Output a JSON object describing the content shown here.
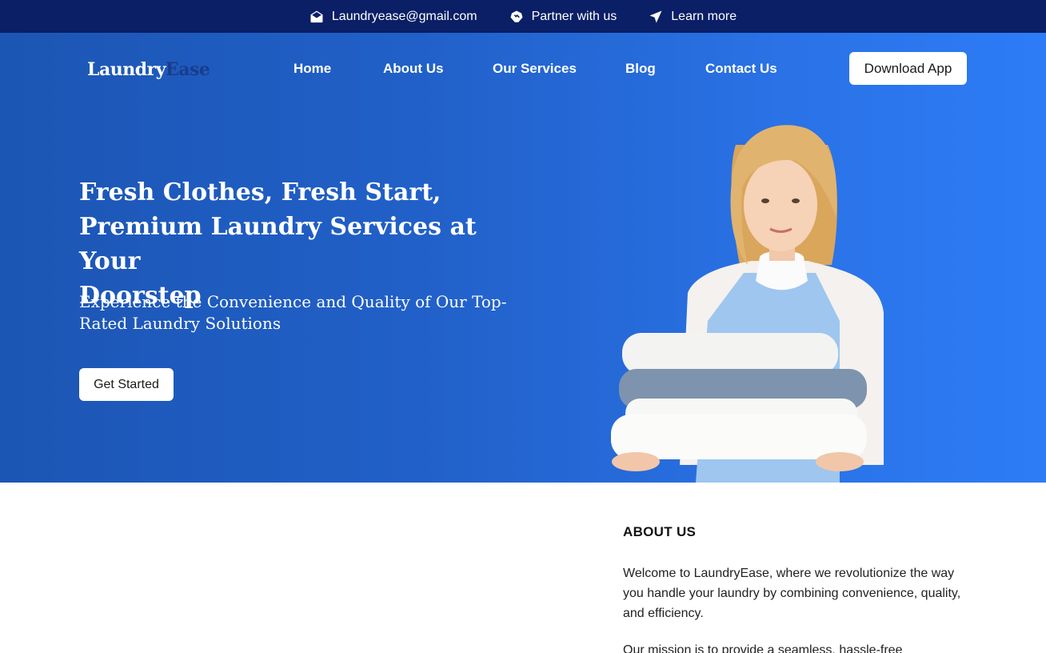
{
  "topbar": {
    "items": [
      {
        "icon": "envelope-icon",
        "label": "Laundryease@gmail.com"
      },
      {
        "icon": "handshake-icon",
        "label": "Partner with us"
      },
      {
        "icon": "send-icon",
        "label": "Learn more"
      }
    ]
  },
  "brand": {
    "part1": "Laundry",
    "part2": "Ease"
  },
  "nav": {
    "items": [
      "Home",
      "About Us",
      "Our Services",
      "Blog",
      "Contact Us"
    ],
    "cta": "Download App"
  },
  "hero": {
    "title_line1": "Fresh Clothes, Fresh Start,",
    "title_line2": "Premium Laundry Services at Your",
    "title_line3": "Doorstep",
    "subtitle": "Experience the Convenience and Quality of Our Top-Rated Laundry Solutions",
    "cta": "Get Started"
  },
  "about": {
    "heading": "ABOUT US",
    "paragraph1": "Welcome to LaundryEase, where we revolutionize the way you handle your laundry by combining convenience, quality, and efficiency.",
    "paragraph2": "Our mission is to provide a seamless, hassle-free"
  },
  "colors": {
    "topbar": "#0a1f66",
    "hero_start": "#1c56b4",
    "hero_end": "#2d7cf6",
    "brand_accent": "#1a3c8c"
  }
}
